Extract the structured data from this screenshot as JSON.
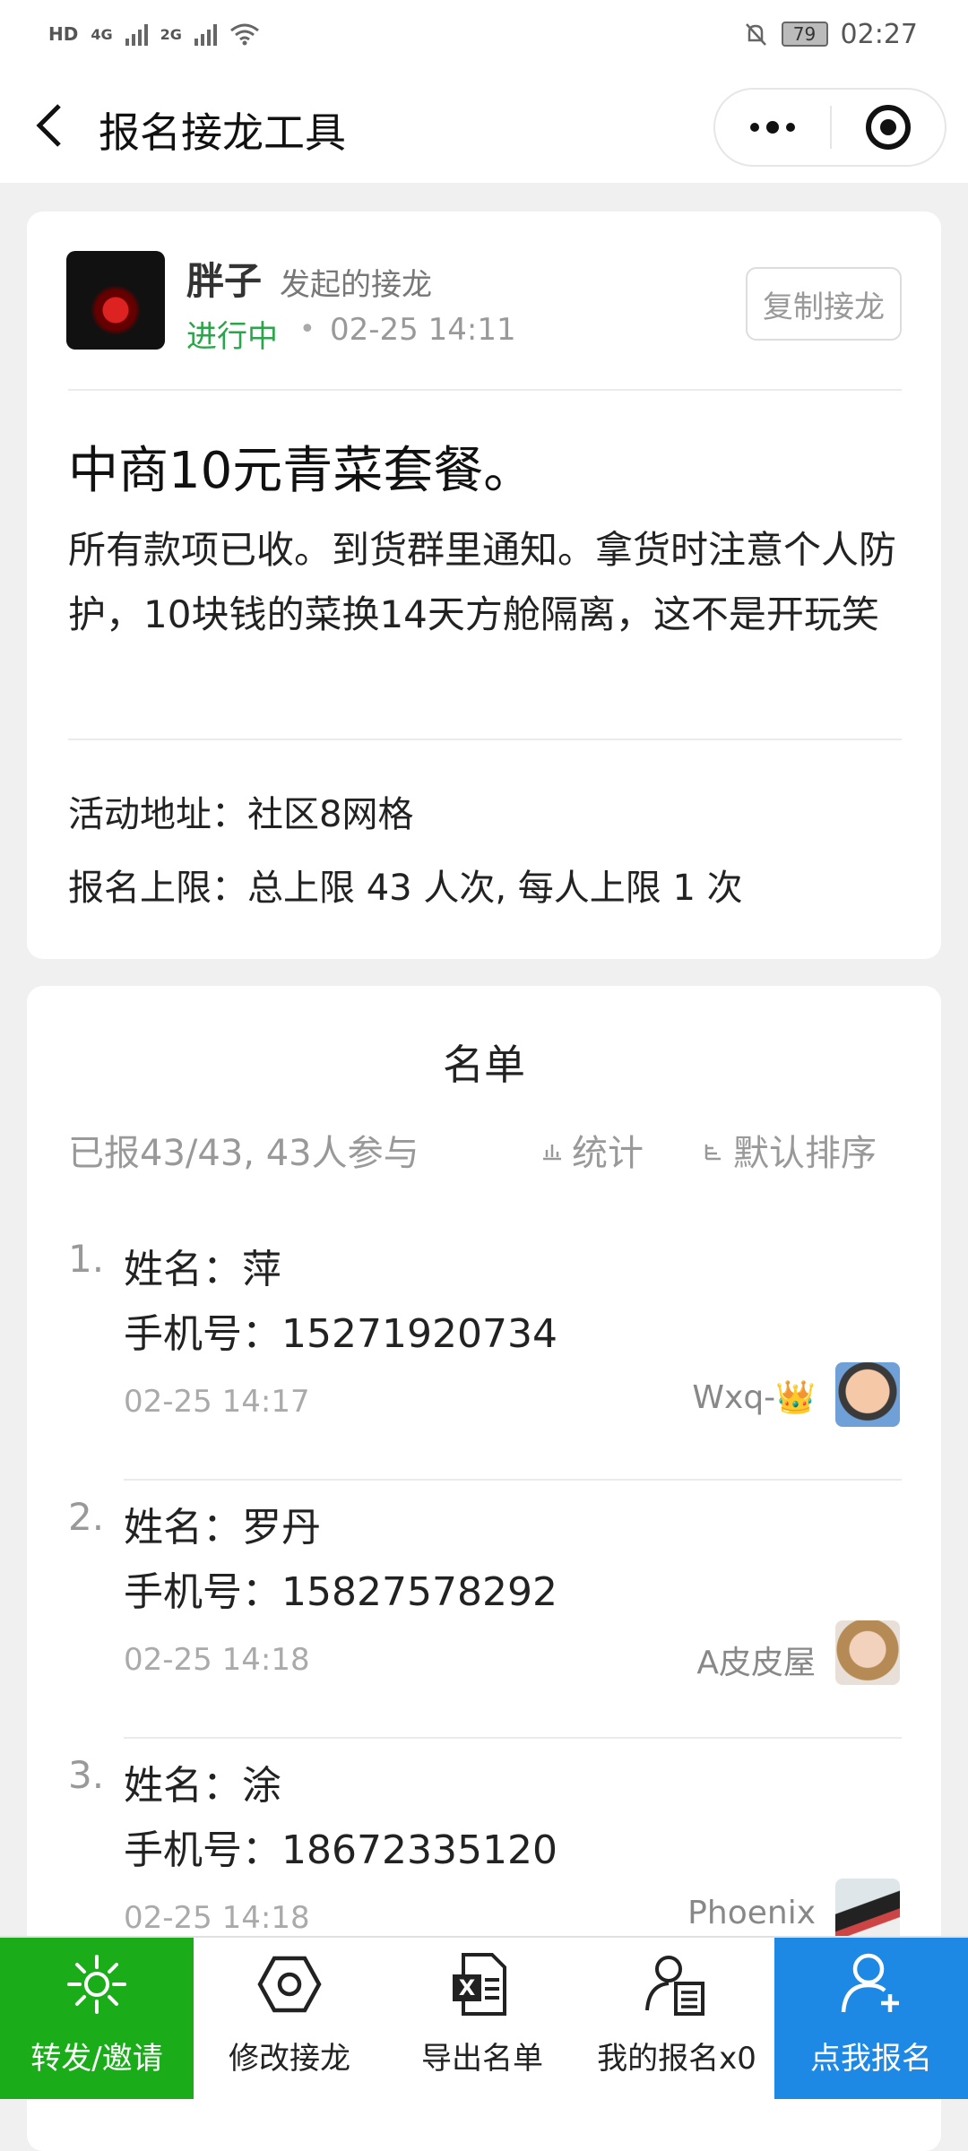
{
  "status_bar": {
    "left_labels": [
      "HD",
      "4G",
      "2G"
    ],
    "battery": "79",
    "time": "02:27"
  },
  "nav": {
    "title": "报名接龙工具"
  },
  "post": {
    "host_name": "胖子",
    "host_suffix": "发起的接龙",
    "status": "进行中",
    "separator": "•",
    "time": "02-25 14:11",
    "copy_label": "复制接龙",
    "title": "中商10元青菜套餐。",
    "body": "所有款项已收。到货群里通知。拿货时注意个人防护，10块钱的菜换14天方舱隔离，这不是开玩笑",
    "address": "活动地址：社区8网格",
    "limit": "报名上限：总上限 43 人次, 每人上限 1 次"
  },
  "list": {
    "title": "名单",
    "summary": "已报43/43, 43人参与",
    "stats_label": "统计",
    "sort_label": "默认排序",
    "entries": [
      {
        "index": "1.",
        "name": "姓名：萍",
        "phone": "手机号：15271920734",
        "time": "02-25 14:17",
        "user": "Wxq-👑"
      },
      {
        "index": "2.",
        "name": "姓名：罗丹",
        "phone": "手机号：15827578292",
        "time": "02-25 14:18",
        "user": "A皮皮屋"
      },
      {
        "index": "3.",
        "name": "姓名：涂",
        "phone": "手机号：18672335120",
        "time": "02-25 14:18",
        "user": "Phoenix"
      }
    ]
  },
  "toolbar": {
    "share": "转发/邀请",
    "edit": "修改接龙",
    "export": "导出名单",
    "mine": "我的报名x0",
    "join": "点我报名"
  },
  "colors": {
    "green": "#1aad19",
    "blue": "#1e88e5",
    "status_green": "#2aa54a"
  }
}
